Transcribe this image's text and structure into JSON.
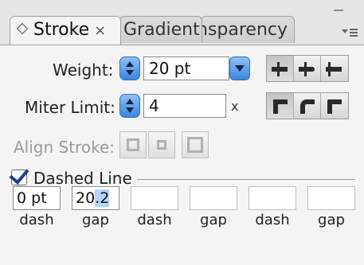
{
  "tabs": [
    {
      "label": "Stroke",
      "active": true
    },
    {
      "label": "Gradient",
      "active": false
    },
    {
      "label": "Transparency",
      "visible_fragment": "nsparency",
      "active": false
    }
  ],
  "weight": {
    "label": "Weight:",
    "value": "20 pt"
  },
  "miter": {
    "label": "Miter Limit:",
    "value": "4",
    "unit": "x"
  },
  "align": {
    "label": "Align Stroke:"
  },
  "dashed": {
    "label": "Dashed Line",
    "checked": true
  },
  "dash_fields": [
    {
      "value": "0 pt",
      "label": "dash"
    },
    {
      "value": "20.2",
      "label": "gap"
    },
    {
      "value": "",
      "label": "dash"
    },
    {
      "value": "",
      "label": "gap"
    },
    {
      "value": "",
      "label": "dash"
    },
    {
      "value": "",
      "label": "gap"
    }
  ],
  "cap_buttons": [
    "butt-cap-icon",
    "round-cap-icon",
    "projecting-cap-icon"
  ],
  "join_buttons": [
    "miter-join-icon",
    "round-join-icon",
    "bevel-join-icon"
  ],
  "colors": {
    "accent": "#3a86df",
    "panel": "#f4f4f4",
    "disabled": "#9a9a9a"
  }
}
